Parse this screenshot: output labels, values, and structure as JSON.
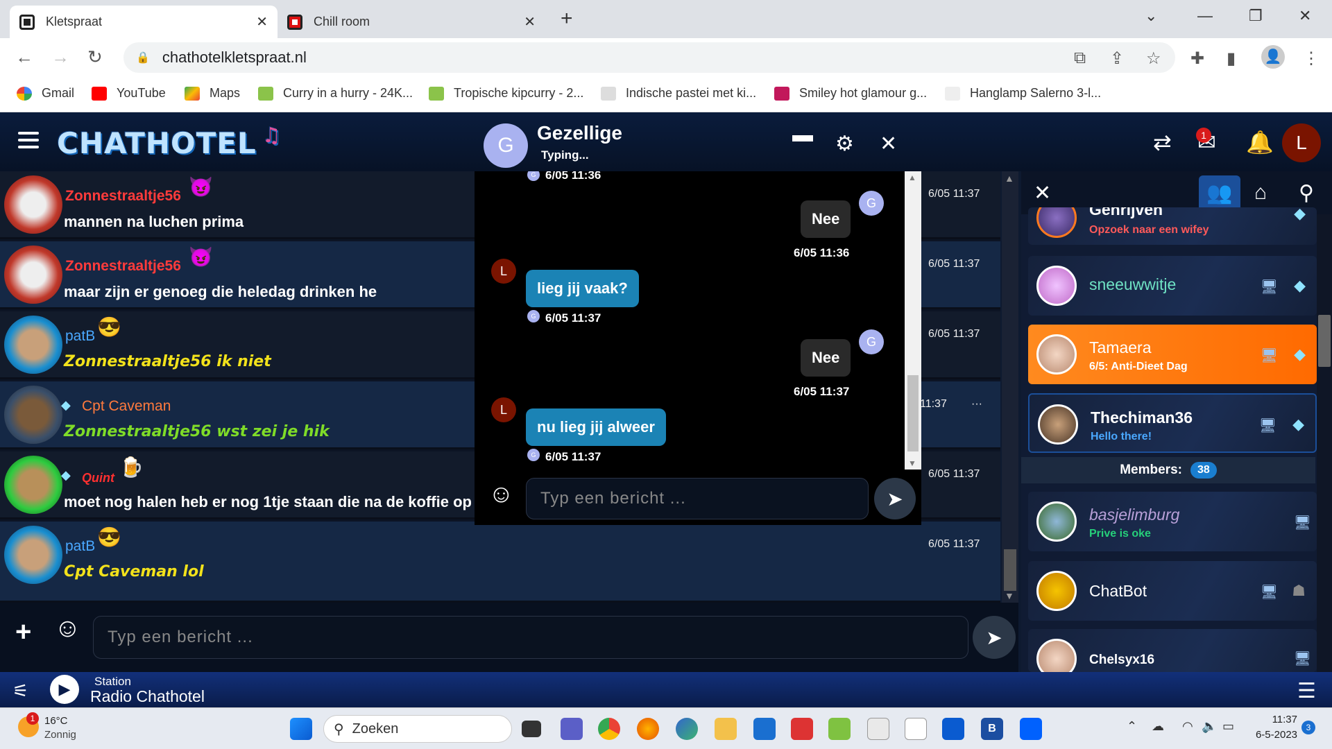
{
  "browser": {
    "tabs": [
      {
        "label": "Kletspraat",
        "active": true
      },
      {
        "label": "Chill room",
        "active": false
      }
    ],
    "url": "chathotelkletspraat.nl",
    "bookmarks": [
      "Gmail",
      "YouTube",
      "Maps",
      "Curry in a hurry - 24K...",
      "Tropische kipcurry - 2...",
      "Indische pastei met ki...",
      "Smiley hot glamour g...",
      "Hanglamp Salerno 3-l..."
    ]
  },
  "app": {
    "logo": "CHATHOTEL",
    "user_initial": "L",
    "mail_badge": "1",
    "feed": [
      {
        "user": "Zonnestraaltje56",
        "color": "#ff3b3b",
        "text": "mannen na luchen prima",
        "time": "6/05 11:37",
        "italic": false,
        "emoji": "😈"
      },
      {
        "user": "Zonnestraaltje56",
        "color": "#ff3b3b",
        "text": "maar zijn er genoeg die heledag drinken he",
        "time": "6/05 11:37",
        "italic": false,
        "emoji": "😈"
      },
      {
        "user": "patB",
        "color": "#4aa8ff",
        "text": "Zonnestraaltje56 ik niet",
        "time": "6/05 11:37",
        "italic": true,
        "textcolor": "#f2e21b",
        "emoji": "😎"
      },
      {
        "user": "Cpt Caveman",
        "color": "#ff7a3d",
        "text": "Zonnestraaltje56 wst zei je hik",
        "time": "11:37",
        "italic": true,
        "textcolor": "#7fdc28",
        "emoji": ""
      },
      {
        "user": "Quint",
        "color": "#ff3030",
        "text": "moet nog halen heb er nog 1tje staan die na de koffie op",
        "time": "6/05 11:37",
        "italic": false,
        "emoji": "🍺"
      },
      {
        "user": "patB",
        "color": "#4aa8ff",
        "text": "Cpt Caveman lol",
        "time": "6/05 11:37",
        "italic": true,
        "textcolor": "#f2e21b",
        "emoji": "😎"
      }
    ],
    "input_placeholder": "Typ een bericht ...",
    "members_label": "Members:",
    "members_count": "38",
    "online": [
      {
        "name": "Gehrijven",
        "status": "Opzoek naar een wifey",
        "status_color": "#ff5a5a"
      },
      {
        "name": "sneeuwwitje",
        "status": "",
        "name_color": "#6fe2c4"
      },
      {
        "name": "Tamaera",
        "status": "6/5: Anti-Dieet Dag",
        "status_color": "#fff",
        "highlight": true
      },
      {
        "name": "Thechiman36",
        "status": "Hello there!",
        "status_color": "#4aa8ff"
      }
    ],
    "members": [
      {
        "name": "basjelimburg",
        "status": "Prive is oke",
        "name_color": "#b8a0d8",
        "status_color": "#26d07a"
      },
      {
        "name": "ChatBot",
        "status": ""
      },
      {
        "name": "Chelsyx16",
        "status": ""
      }
    ],
    "player": {
      "label": "Station",
      "station": "Radio Chathotel"
    }
  },
  "popup": {
    "title": "Gezellige",
    "subtitle": "Typing...",
    "avatar": "G",
    "messages": [
      {
        "who": "them",
        "text": "",
        "time": "6/05 11:36"
      },
      {
        "who": "them",
        "text": "Nee",
        "time": "6/05 11:36"
      },
      {
        "who": "me",
        "text": "lieg jij vaak?",
        "time": "6/05 11:37"
      },
      {
        "who": "them",
        "text": "Nee",
        "time": "6/05 11:37"
      },
      {
        "who": "me",
        "text": "nu lieg jij alweer",
        "time": "6/05 11:37"
      }
    ],
    "input_placeholder": "Typ een bericht ..."
  },
  "taskbar": {
    "weather_temp": "16°C",
    "weather_desc": "Zonnig",
    "weather_badge": "1",
    "search": "Zoeken",
    "clock_time": "11:37",
    "clock_date": "6-5-2023",
    "notif": "3"
  },
  "icons": [
    "menu-icon",
    "repeat-icon",
    "mail-icon",
    "bell-icon",
    "users-icon",
    "home-icon",
    "search-icon",
    "close-icon",
    "settings-icon",
    "minimize-icon",
    "emoji-icon",
    "send-icon",
    "plus-icon",
    "play-icon",
    "equalizer-icon",
    "diamond-icon",
    "desktop-icon"
  ]
}
